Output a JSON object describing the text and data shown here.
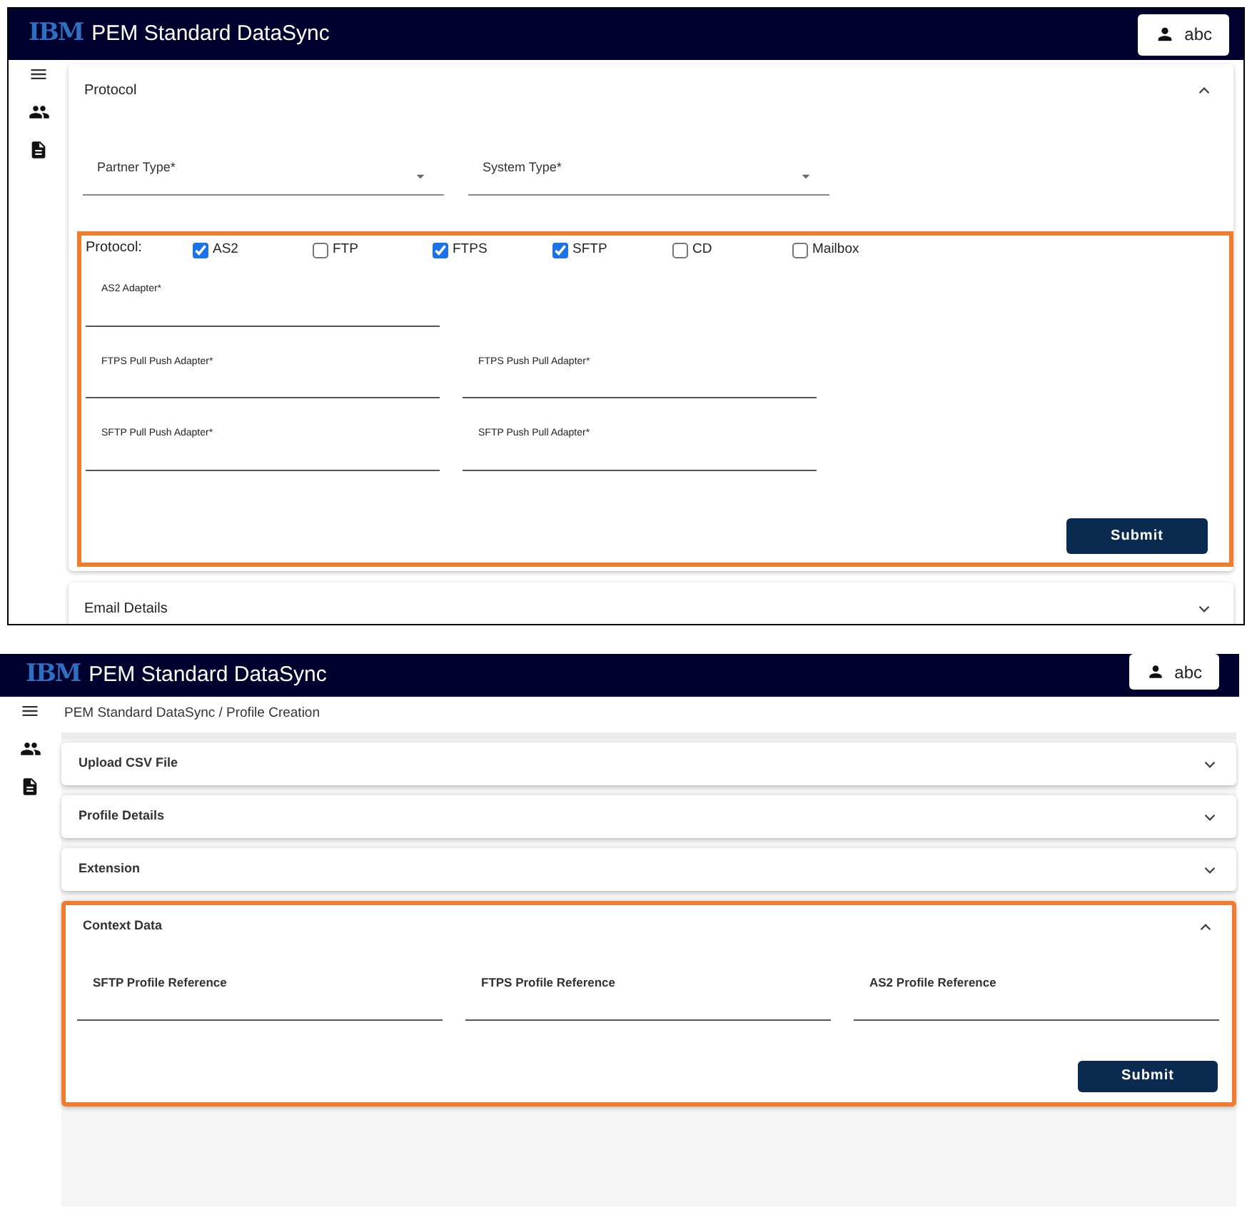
{
  "screens": [
    {
      "header": {
        "logo": "IBM",
        "title": "PEM Standard DataSync",
        "user": "abc"
      },
      "sections": [
        {
          "title": "Protocol",
          "expanded": true,
          "highlighted": false,
          "selects": [
            {
              "label": "Partner Type*"
            },
            {
              "label": "System Type*"
            }
          ],
          "protocol": {
            "label": "Protocol:",
            "highlighted": true,
            "options": [
              {
                "label": "AS2",
                "checked": true
              },
              {
                "label": "FTP",
                "checked": false
              },
              {
                "label": "FTPS",
                "checked": true
              },
              {
                "label": "SFTP",
                "checked": true
              },
              {
                "label": "CD",
                "checked": false
              },
              {
                "label": "Mailbox",
                "checked": false
              }
            ],
            "field_rows": [
              [
                {
                  "label": "AS2 Adapter*"
                }
              ],
              [
                {
                  "label": "FTPS Pull Push Adapter*"
                },
                {
                  "label": "FTPS Push Pull Adapter*"
                }
              ],
              [
                {
                  "label": "SFTP Pull Push Adapter*"
                },
                {
                  "label": "SFTP Push Pull Adapter*"
                }
              ]
            ],
            "submit": "Submit"
          }
        },
        {
          "title": "Email Details",
          "expanded": false,
          "highlighted": false
        }
      ]
    },
    {
      "header": {
        "logo": "IBM",
        "title": "PEM Standard DataSync",
        "user": "abc"
      },
      "breadcrumb": "PEM Standard DataSync / Profile Creation",
      "sections": [
        {
          "title": "Upload CSV File",
          "expanded": false,
          "highlighted": false
        },
        {
          "title": "Profile Details",
          "expanded": false,
          "highlighted": false
        },
        {
          "title": "Extension",
          "expanded": false,
          "highlighted": false
        },
        {
          "title": "Context Data",
          "expanded": true,
          "highlighted": true,
          "fields": [
            {
              "label": "SFTP Profile Reference"
            },
            {
              "label": "FTPS Profile Reference"
            },
            {
              "label": "AS2 Profile Reference"
            }
          ],
          "submit": "Submit"
        }
      ]
    }
  ]
}
